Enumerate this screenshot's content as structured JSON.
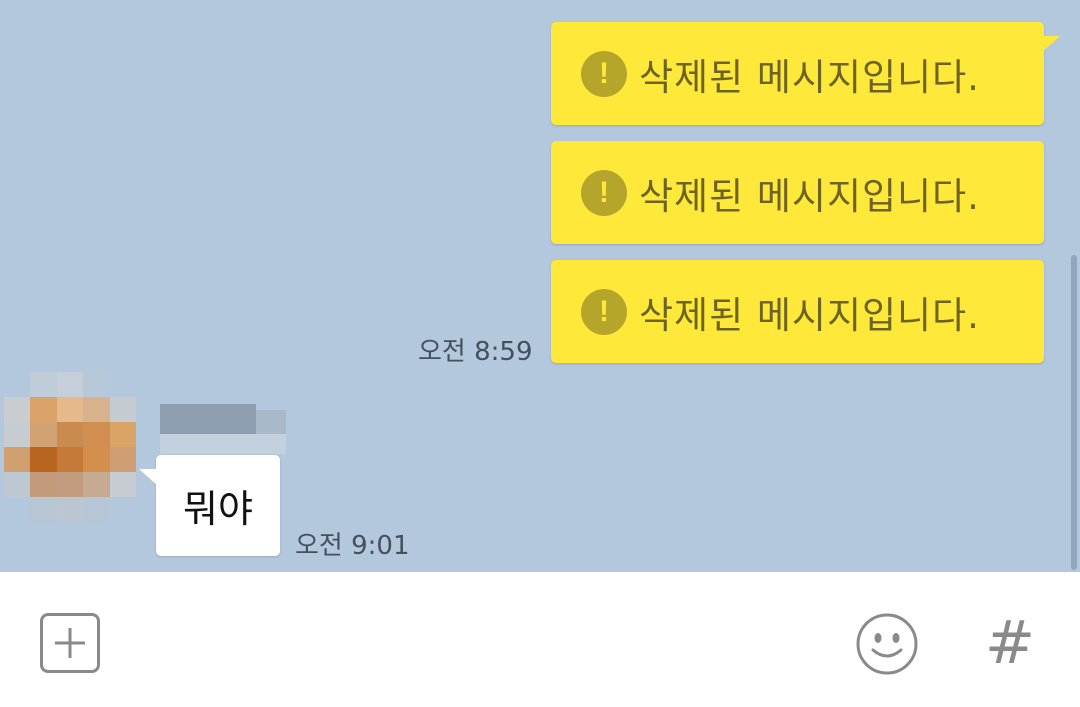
{
  "messages_sent": [
    {
      "text": "삭제된 메시지입니다.",
      "icon": "alert-icon",
      "icon_glyph": "!"
    },
    {
      "text": "삭제된 메시지입니다.",
      "icon": "alert-icon",
      "icon_glyph": "!"
    },
    {
      "text": "삭제된 메시지입니다.",
      "icon": "alert-icon",
      "icon_glyph": "!"
    }
  ],
  "sent_time": "오전 8:59",
  "received": {
    "text": "뭐야",
    "time": "오전 9:01"
  },
  "input_bar": {
    "plus_icon": "plus-icon",
    "emoji_icon": "emoji-icon",
    "hash_icon": "hash-icon",
    "hash_glyph": "#"
  },
  "colors": {
    "chat_background": "#b3c8dd",
    "sent_bubble": "#fee93b",
    "received_bubble": "#ffffff"
  }
}
